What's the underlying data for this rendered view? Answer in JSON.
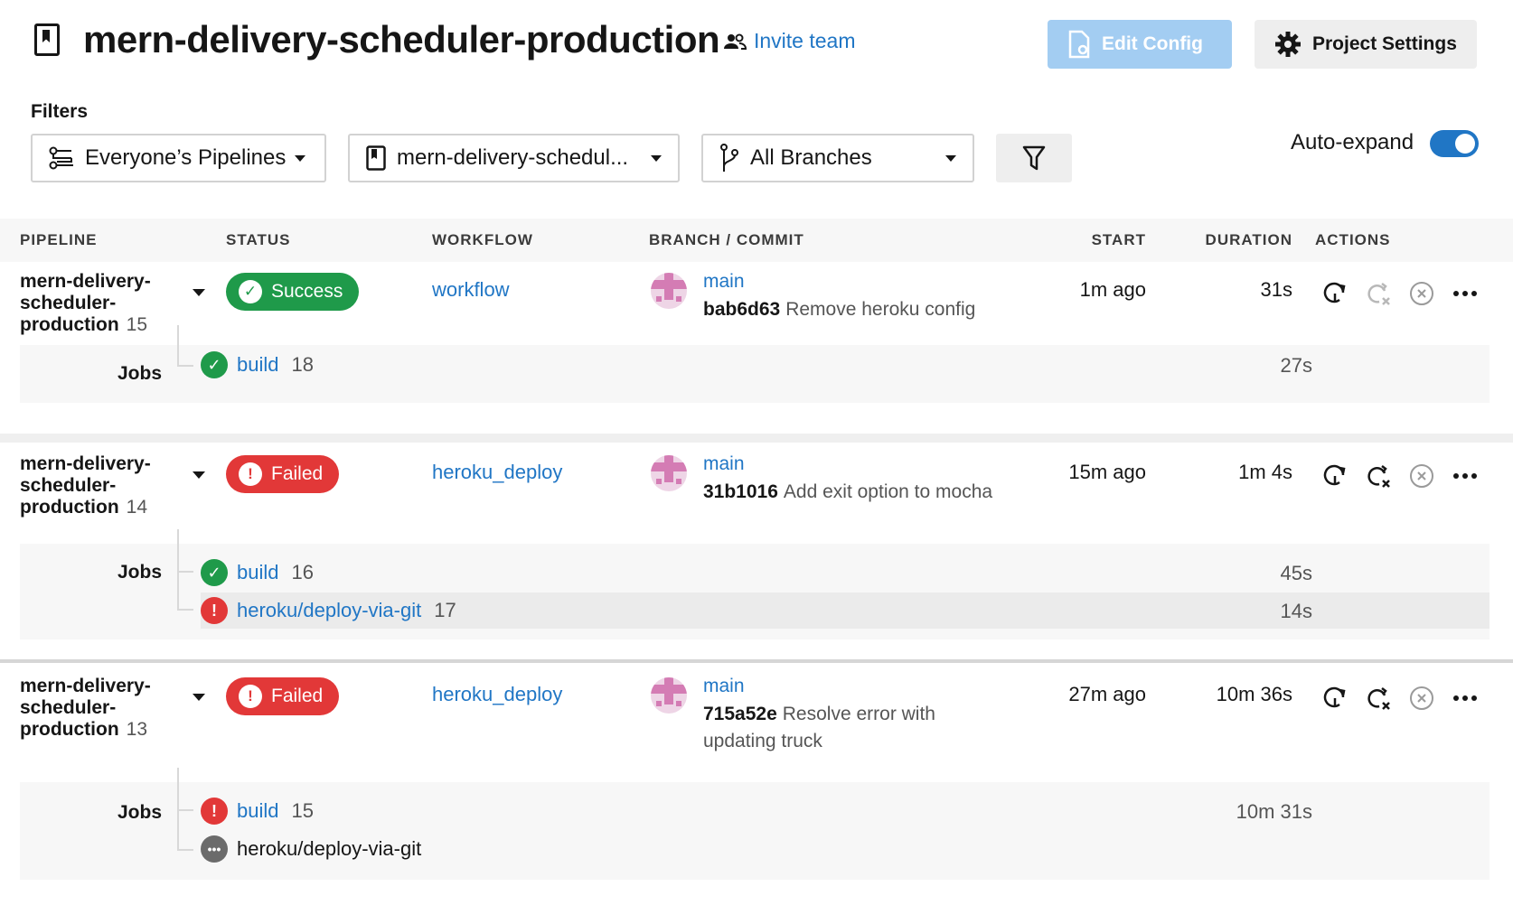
{
  "header": {
    "title": "mern-delivery-scheduler-production",
    "invite_label": "Invite team",
    "edit_config_label": "Edit Config",
    "project_settings_label": "Project Settings"
  },
  "filters": {
    "label": "Filters",
    "pipelines_value": "Everyone’s Pipelines",
    "project_value": "mern-delivery-schedul...",
    "branch_value": "All Branches",
    "auto_expand_label": "Auto-expand",
    "auto_expand_on": true
  },
  "columns": {
    "pipeline": "PIPELINE",
    "status": "STATUS",
    "workflow": "WORKFLOW",
    "branch_commit": "BRANCH / COMMIT",
    "start": "START",
    "duration": "DURATION",
    "actions": "ACTIONS"
  },
  "jobs_label": "Jobs",
  "pipelines": [
    {
      "name": "mern-delivery-scheduler-production",
      "number": "15",
      "status": "Success",
      "workflow": "workflow",
      "branch": "main",
      "commit_hash": "bab6d63",
      "commit_msg": "Remove heroku config",
      "start": "1m ago",
      "duration": "31s",
      "jobs": [
        {
          "name": "build",
          "number": "18",
          "status": "success",
          "duration": "27s"
        }
      ]
    },
    {
      "name": "mern-delivery-scheduler-production",
      "number": "14",
      "status": "Failed",
      "workflow": "heroku_deploy",
      "branch": "main",
      "commit_hash": "31b1016",
      "commit_msg": "Add exit option to mocha",
      "start": "15m ago",
      "duration": "1m 4s",
      "jobs": [
        {
          "name": "build",
          "number": "16",
          "status": "success",
          "duration": "45s"
        },
        {
          "name": "heroku/deploy-via-git",
          "number": "17",
          "status": "failed",
          "duration": "14s"
        }
      ]
    },
    {
      "name": "mern-delivery-scheduler-production",
      "number": "13",
      "status": "Failed",
      "workflow": "heroku_deploy",
      "branch": "main",
      "commit_hash": "715a52e",
      "commit_msg": "Resolve error with updating truck",
      "start": "27m ago",
      "duration": "10m 36s",
      "jobs": [
        {
          "name": "build",
          "number": "15",
          "status": "failed",
          "duration": "10m 31s"
        },
        {
          "name": "heroku/deploy-via-git",
          "number": "",
          "status": "pending",
          "duration": ""
        }
      ]
    }
  ],
  "colors": {
    "link": "#2076c5",
    "success": "#1f9a4a",
    "failed": "#e23838",
    "edit_config_bg": "#a3cdf2"
  }
}
